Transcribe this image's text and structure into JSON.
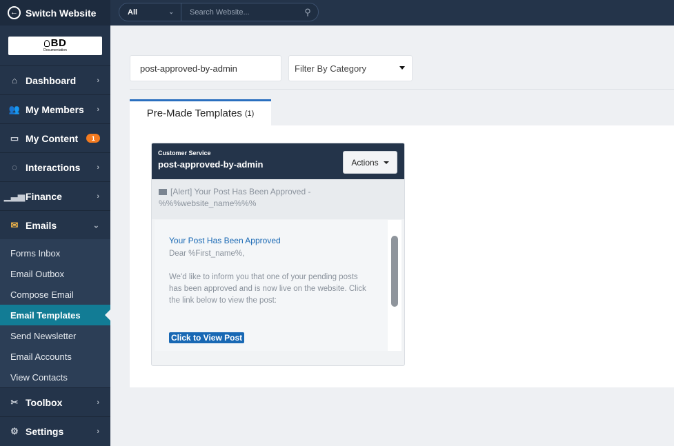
{
  "sidebar": {
    "switch_label": "Switch Website",
    "logo_text": "BD",
    "logo_sub": "Documentation",
    "items": [
      {
        "label": "Dashboard"
      },
      {
        "label": "My Members"
      },
      {
        "label": "My Content",
        "badge": "1"
      },
      {
        "label": "Interactions"
      },
      {
        "label": "Finance"
      },
      {
        "label": "Emails"
      }
    ],
    "email_sub": [
      {
        "label": "Forms Inbox"
      },
      {
        "label": "Email Outbox"
      },
      {
        "label": "Compose Email"
      },
      {
        "label": "Email Templates"
      },
      {
        "label": "Send Newsletter"
      },
      {
        "label": "Email Accounts"
      },
      {
        "label": "View Contacts"
      }
    ],
    "bottom_items": [
      {
        "label": "Toolbox"
      },
      {
        "label": "Settings"
      }
    ]
  },
  "topbar": {
    "scope": "All",
    "search_placeholder": "Search Website..."
  },
  "filters": {
    "search_value": "post-approved-by-admin",
    "category_label": "Filter By Category"
  },
  "tab": {
    "label": "Pre-Made Templates",
    "count": "(1)"
  },
  "card": {
    "category": "Customer Service",
    "name": "post-approved-by-admin",
    "actions_label": "Actions",
    "subject": "[Alert] Your Post Has Been Approved - %%%website_name%%%",
    "preview_title": "Your Post Has Been Approved",
    "preview_greeting": "Dear %First_name%,",
    "preview_body": "We'd like to inform you that one of your pending posts has been approved and is now live on the website. Click the link below to view the post:",
    "preview_button": "Click to View Post"
  },
  "colors": {
    "sidebar_bg": "#24344a",
    "active_item": "#127c95",
    "badge": "#f47b20",
    "accent_blue": "#1868b4"
  }
}
